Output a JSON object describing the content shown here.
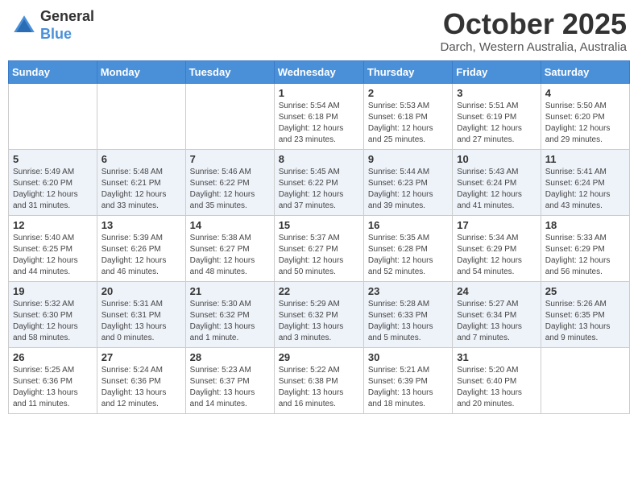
{
  "header": {
    "logo_general": "General",
    "logo_blue": "Blue",
    "month_title": "October 2025",
    "location": "Darch, Western Australia, Australia"
  },
  "weekdays": [
    "Sunday",
    "Monday",
    "Tuesday",
    "Wednesday",
    "Thursday",
    "Friday",
    "Saturday"
  ],
  "weeks": [
    [
      {
        "day": "",
        "info": ""
      },
      {
        "day": "",
        "info": ""
      },
      {
        "day": "",
        "info": ""
      },
      {
        "day": "1",
        "info": "Sunrise: 5:54 AM\nSunset: 6:18 PM\nDaylight: 12 hours\nand 23 minutes."
      },
      {
        "day": "2",
        "info": "Sunrise: 5:53 AM\nSunset: 6:18 PM\nDaylight: 12 hours\nand 25 minutes."
      },
      {
        "day": "3",
        "info": "Sunrise: 5:51 AM\nSunset: 6:19 PM\nDaylight: 12 hours\nand 27 minutes."
      },
      {
        "day": "4",
        "info": "Sunrise: 5:50 AM\nSunset: 6:20 PM\nDaylight: 12 hours\nand 29 minutes."
      }
    ],
    [
      {
        "day": "5",
        "info": "Sunrise: 5:49 AM\nSunset: 6:20 PM\nDaylight: 12 hours\nand 31 minutes."
      },
      {
        "day": "6",
        "info": "Sunrise: 5:48 AM\nSunset: 6:21 PM\nDaylight: 12 hours\nand 33 minutes."
      },
      {
        "day": "7",
        "info": "Sunrise: 5:46 AM\nSunset: 6:22 PM\nDaylight: 12 hours\nand 35 minutes."
      },
      {
        "day": "8",
        "info": "Sunrise: 5:45 AM\nSunset: 6:22 PM\nDaylight: 12 hours\nand 37 minutes."
      },
      {
        "day": "9",
        "info": "Sunrise: 5:44 AM\nSunset: 6:23 PM\nDaylight: 12 hours\nand 39 minutes."
      },
      {
        "day": "10",
        "info": "Sunrise: 5:43 AM\nSunset: 6:24 PM\nDaylight: 12 hours\nand 41 minutes."
      },
      {
        "day": "11",
        "info": "Sunrise: 5:41 AM\nSunset: 6:24 PM\nDaylight: 12 hours\nand 43 minutes."
      }
    ],
    [
      {
        "day": "12",
        "info": "Sunrise: 5:40 AM\nSunset: 6:25 PM\nDaylight: 12 hours\nand 44 minutes."
      },
      {
        "day": "13",
        "info": "Sunrise: 5:39 AM\nSunset: 6:26 PM\nDaylight: 12 hours\nand 46 minutes."
      },
      {
        "day": "14",
        "info": "Sunrise: 5:38 AM\nSunset: 6:27 PM\nDaylight: 12 hours\nand 48 minutes."
      },
      {
        "day": "15",
        "info": "Sunrise: 5:37 AM\nSunset: 6:27 PM\nDaylight: 12 hours\nand 50 minutes."
      },
      {
        "day": "16",
        "info": "Sunrise: 5:35 AM\nSunset: 6:28 PM\nDaylight: 12 hours\nand 52 minutes."
      },
      {
        "day": "17",
        "info": "Sunrise: 5:34 AM\nSunset: 6:29 PM\nDaylight: 12 hours\nand 54 minutes."
      },
      {
        "day": "18",
        "info": "Sunrise: 5:33 AM\nSunset: 6:29 PM\nDaylight: 12 hours\nand 56 minutes."
      }
    ],
    [
      {
        "day": "19",
        "info": "Sunrise: 5:32 AM\nSunset: 6:30 PM\nDaylight: 12 hours\nand 58 minutes."
      },
      {
        "day": "20",
        "info": "Sunrise: 5:31 AM\nSunset: 6:31 PM\nDaylight: 13 hours\nand 0 minutes."
      },
      {
        "day": "21",
        "info": "Sunrise: 5:30 AM\nSunset: 6:32 PM\nDaylight: 13 hours\nand 1 minute."
      },
      {
        "day": "22",
        "info": "Sunrise: 5:29 AM\nSunset: 6:32 PM\nDaylight: 13 hours\nand 3 minutes."
      },
      {
        "day": "23",
        "info": "Sunrise: 5:28 AM\nSunset: 6:33 PM\nDaylight: 13 hours\nand 5 minutes."
      },
      {
        "day": "24",
        "info": "Sunrise: 5:27 AM\nSunset: 6:34 PM\nDaylight: 13 hours\nand 7 minutes."
      },
      {
        "day": "25",
        "info": "Sunrise: 5:26 AM\nSunset: 6:35 PM\nDaylight: 13 hours\nand 9 minutes."
      }
    ],
    [
      {
        "day": "26",
        "info": "Sunrise: 5:25 AM\nSunset: 6:36 PM\nDaylight: 13 hours\nand 11 minutes."
      },
      {
        "day": "27",
        "info": "Sunrise: 5:24 AM\nSunset: 6:36 PM\nDaylight: 13 hours\nand 12 minutes."
      },
      {
        "day": "28",
        "info": "Sunrise: 5:23 AM\nSunset: 6:37 PM\nDaylight: 13 hours\nand 14 minutes."
      },
      {
        "day": "29",
        "info": "Sunrise: 5:22 AM\nSunset: 6:38 PM\nDaylight: 13 hours\nand 16 minutes."
      },
      {
        "day": "30",
        "info": "Sunrise: 5:21 AM\nSunset: 6:39 PM\nDaylight: 13 hours\nand 18 minutes."
      },
      {
        "day": "31",
        "info": "Sunrise: 5:20 AM\nSunset: 6:40 PM\nDaylight: 13 hours\nand 20 minutes."
      },
      {
        "day": "",
        "info": ""
      }
    ]
  ]
}
